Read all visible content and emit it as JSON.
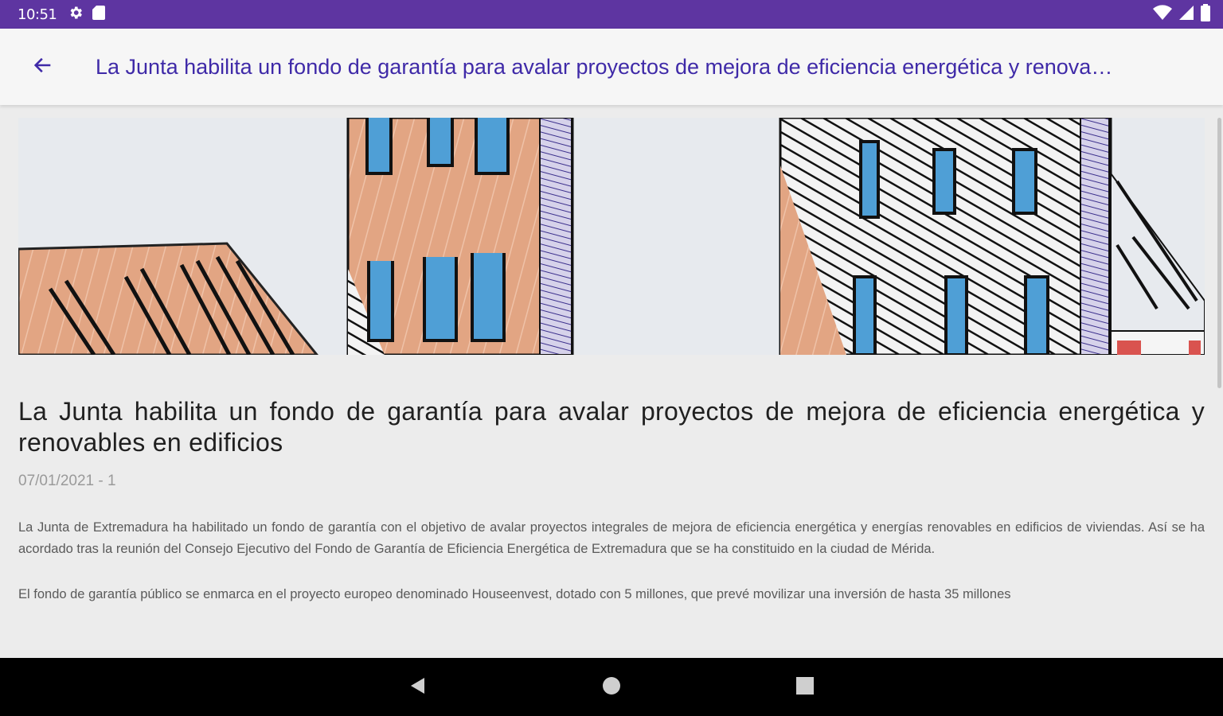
{
  "status_bar": {
    "time": "10:51",
    "left_icons": [
      "gear-icon",
      "sd-card-icon"
    ],
    "right_icons": [
      "wifi-icon",
      "signal-icon",
      "battery-icon"
    ],
    "color": "#5e35a1"
  },
  "app_bar": {
    "title": "La Junta habilita un fondo de garantía para avalar proyectos de mejora de eficiencia energética y renovables en edificios",
    "back_icon": "arrow-left-icon",
    "accent": "#3f2aa8"
  },
  "article": {
    "title": "La Junta habilita un fondo de garantía para avalar proyectos de mejora de eficiencia energética y renovables en edificios",
    "meta": "07/01/2021 - 1",
    "paragraphs": [
      "La Junta de Extremadura ha habilitado un fondo de garantía con el objetivo de avalar proyectos integrales de mejora de eficiencia energética y energías renovables en edificios de viviendas. Así se ha acordado tras la reunión del Consejo Ejecutivo del Fondo de Garantía de Eficiencia Energética de Extremadura que se ha constituido en la ciudad de Mérida.",
      "El fondo de garantía público se enmarca en el proyecto europeo denominado Houseenvest, dotado con 5 millones, que prevé movilizar una inversión de hasta 35 millones"
    ]
  },
  "nav_bar": {
    "icons": [
      "back-triangle-icon",
      "home-circle-icon",
      "recents-square-icon"
    ]
  }
}
